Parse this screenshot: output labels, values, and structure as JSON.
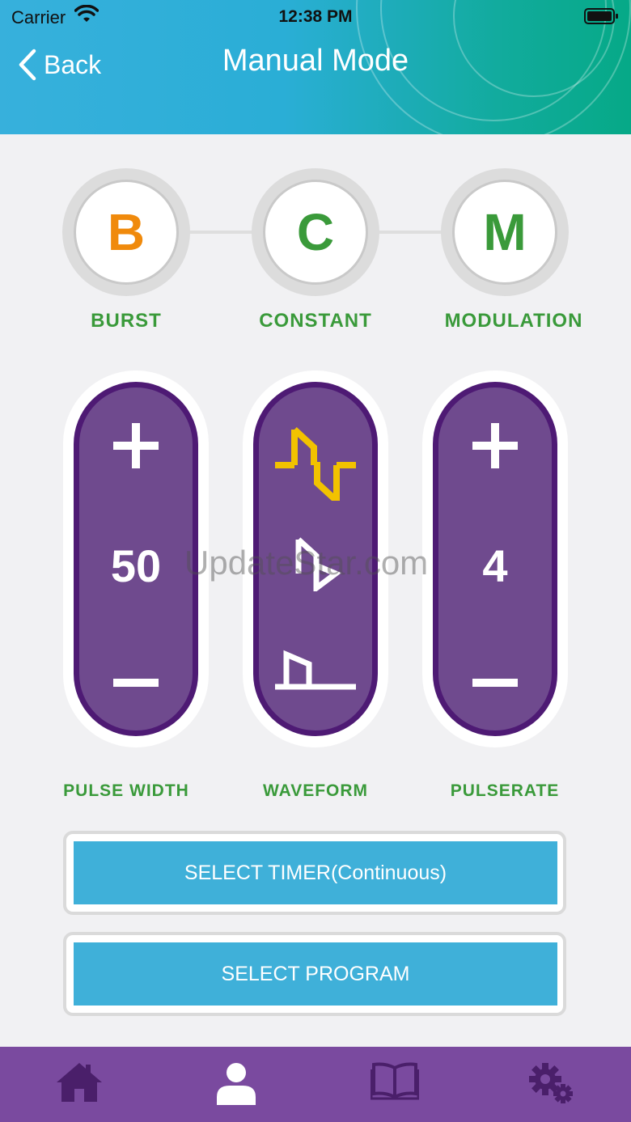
{
  "status_bar": {
    "carrier": "Carrier",
    "time": "12:38 PM"
  },
  "nav": {
    "back_label": "Back",
    "title": "Manual Mode"
  },
  "modes": [
    {
      "letter": "B",
      "label": "BURST",
      "color": "#f08a0c"
    },
    {
      "letter": "C",
      "label": "CONSTANT",
      "color": "#3a9a3a"
    },
    {
      "letter": "M",
      "label": "MODULATION",
      "color": "#3a9a3a"
    }
  ],
  "controls": {
    "pulse_width": {
      "label": "PULSE WIDTH",
      "value": "50"
    },
    "waveform": {
      "label": "WAVEFORM"
    },
    "pulserate": {
      "label": "PULSERATE",
      "value": "4"
    }
  },
  "watermark": "UpdateStar.com",
  "actions": {
    "timer_label": "SELECT TIMER(Continuous)",
    "program_label": "SELECT PROGRAM"
  },
  "tabbar": {
    "tabs": [
      "home-icon",
      "user-icon",
      "book-icon",
      "settings-icon"
    ],
    "active": 1
  },
  "colors": {
    "accent_blue": "#3fb0d9",
    "purple": "#6f4a8e",
    "green_label": "#3a9a3a",
    "orange": "#f08a0c",
    "tabbar": "#7a4a9f",
    "active_wave": "#f2c200"
  }
}
